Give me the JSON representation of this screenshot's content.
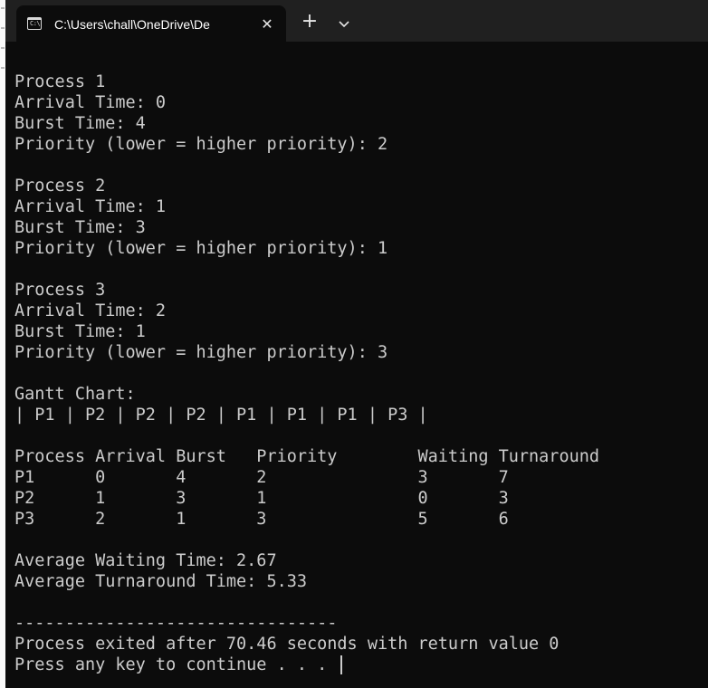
{
  "window": {
    "tab_title": "C:\\Users\\chall\\OneDrive\\De",
    "tab_icon_text": "C:\\",
    "close_glyph": "✕",
    "new_tab_glyph": "+"
  },
  "console_lines": [
    "Process 1",
    "Arrival Time: 0",
    "Burst Time: 4",
    "Priority (lower = higher priority): 2",
    "",
    "Process 2",
    "Arrival Time: 1",
    "Burst Time: 3",
    "Priority (lower = higher priority): 1",
    "",
    "Process 3",
    "Arrival Time: 2",
    "Burst Time: 1",
    "Priority (lower = higher priority): 3",
    "",
    "Gantt Chart:",
    "| P1 | P2 | P2 | P2 | P1 | P1 | P1 | P3 |",
    "",
    "Process Arrival Burst   Priority        Waiting Turnaround",
    "P1      0       4       2               3       7",
    "P2      1       3       1               0       3",
    "P3      2       1       3               5       6",
    "",
    "Average Waiting Time: 2.67",
    "Average Turnaround Time: 5.33",
    "",
    "--------------------------------",
    "Process exited after 70.46 seconds with return value 0",
    "Press any key to continue . . . "
  ],
  "colors": {
    "console_bg": "#0c0c0c",
    "console_fg": "#cccccc",
    "titlebar_bg": "#202020"
  }
}
